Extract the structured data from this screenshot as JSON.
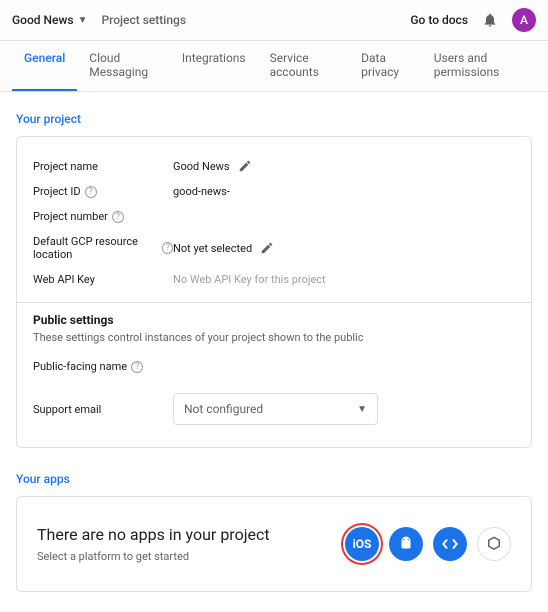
{
  "topbar": {
    "project_name": "Good News",
    "breadcrumb": "Project settings",
    "goto_docs": "Go to docs",
    "avatar_initial": "A"
  },
  "tabs": {
    "items": [
      {
        "label": "General"
      },
      {
        "label": "Cloud Messaging"
      },
      {
        "label": "Integrations"
      },
      {
        "label": "Service accounts"
      },
      {
        "label": "Data privacy"
      },
      {
        "label": "Users and permissions"
      }
    ]
  },
  "your_project": {
    "section_label": "Your project",
    "rows": {
      "project_name": {
        "label": "Project name",
        "value": "Good News"
      },
      "project_id": {
        "label": "Project ID",
        "value": "good-news-"
      },
      "project_number": {
        "label": "Project number",
        "value": ""
      },
      "gcp_location": {
        "label": "Default GCP resource location",
        "value": "Not yet selected"
      },
      "web_api_key": {
        "label": "Web API Key",
        "value": "No Web API Key for this project"
      }
    },
    "public": {
      "header": "Public settings",
      "subtext": "These settings control instances of your project shown to the public",
      "public_name": {
        "label": "Public-facing name",
        "value": ""
      },
      "support_email": {
        "label": "Support email",
        "selected": "Not configured"
      }
    }
  },
  "your_apps": {
    "section_label": "Your apps",
    "headline": "There are no apps in your project",
    "subtext": "Select a platform to get started",
    "platforms": {
      "ios": "iOS",
      "android": "android-icon",
      "web": "web-icon",
      "unity": "unity-icon"
    }
  }
}
